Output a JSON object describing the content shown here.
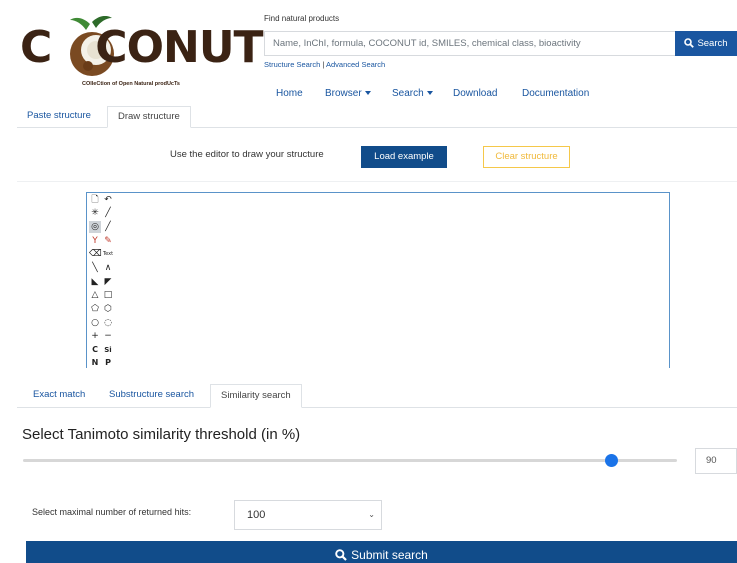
{
  "brand": {
    "logo_text": "COCONUT",
    "logo_subtitle": "COlleCtion of Open Natural prodUcTs",
    "colors": {
      "logo_brown": "#3b2314",
      "primary_blue": "#114c8a",
      "link_blue": "#1a56a0",
      "warning_yellow": "#f0b93a",
      "slider_blue": "#1a73e8"
    }
  },
  "search": {
    "label": "Find natural products",
    "placeholder": "Name, InChI, formula, COCONUT id, SMILES, chemical class, bioactivity",
    "button_label": "Search",
    "button_icon": "magnifier-icon",
    "structure_search_link": "Structure Search",
    "separator": "|",
    "advanced_search_link": "Advanced Search"
  },
  "nav": {
    "items": [
      {
        "label": "Home"
      },
      {
        "label": "Browser",
        "dropdown": true
      },
      {
        "label": "Search",
        "dropdown": true
      },
      {
        "label": "Download"
      },
      {
        "label": "Documentation"
      }
    ]
  },
  "input_tabs": {
    "items": [
      {
        "label": "Paste structure",
        "active": false
      },
      {
        "label": "Draw structure",
        "active": true
      }
    ]
  },
  "draw_panel": {
    "hint": "Use the editor to draw your structure",
    "load_example_label": "Load example",
    "clear_structure_label": "Clear structure"
  },
  "editor": {
    "tools": [
      {
        "name": "new-document-icon",
        "glyph": "🗋"
      },
      {
        "name": "undo-icon",
        "glyph": "↶"
      },
      {
        "name": "atom-map-icon",
        "glyph": "✳"
      },
      {
        "name": "single-bond-icon",
        "glyph": "╱"
      },
      {
        "name": "lasso-icon",
        "glyph": "◎"
      },
      {
        "name": "bond-edit-icon",
        "glyph": "╱"
      },
      {
        "name": "fork-icon",
        "glyph": "Y"
      },
      {
        "name": "eraser-red-icon",
        "glyph": "✎"
      },
      {
        "name": "eraser-icon",
        "glyph": "⌫"
      },
      {
        "name": "text-tool-icon",
        "glyph": "Text"
      },
      {
        "name": "line-icon",
        "glyph": "╲"
      },
      {
        "name": "chain-icon",
        "glyph": "∧"
      },
      {
        "name": "wedge-icon",
        "glyph": "◣"
      },
      {
        "name": "hash-wedge-icon",
        "glyph": "◤"
      },
      {
        "name": "triangle-ring-icon",
        "glyph": "△"
      },
      {
        "name": "square-ring-icon",
        "glyph": "□"
      },
      {
        "name": "pentagon-ring-icon",
        "glyph": "⬠"
      },
      {
        "name": "hexagon-ring-icon",
        "glyph": "⬡"
      },
      {
        "name": "heptagon-ring-icon",
        "glyph": "○"
      },
      {
        "name": "octagon-ring-icon",
        "glyph": "◌"
      },
      {
        "name": "plus-charge-icon",
        "glyph": "+"
      },
      {
        "name": "minus-charge-icon",
        "glyph": "−"
      },
      {
        "name": "carbon-atom-button",
        "glyph": "C"
      },
      {
        "name": "silicon-atom-button",
        "glyph": "Si"
      },
      {
        "name": "nitrogen-atom-button",
        "glyph": "N"
      },
      {
        "name": "phosphorus-atom-button",
        "glyph": "P"
      }
    ]
  },
  "search_type_tabs": {
    "items": [
      {
        "label": "Exact match",
        "active": false
      },
      {
        "label": "Substructure search",
        "active": false
      },
      {
        "label": "Similarity search",
        "active": true
      }
    ]
  },
  "similarity": {
    "title": "Select Tanimoto similarity threshold (in %)",
    "value": "90",
    "slider_fraction": 0.9
  },
  "hits": {
    "label": "Select maximal number of returned hits:",
    "selected": "100"
  },
  "submit": {
    "label": "Submit search",
    "icon": "magnifier-icon"
  }
}
